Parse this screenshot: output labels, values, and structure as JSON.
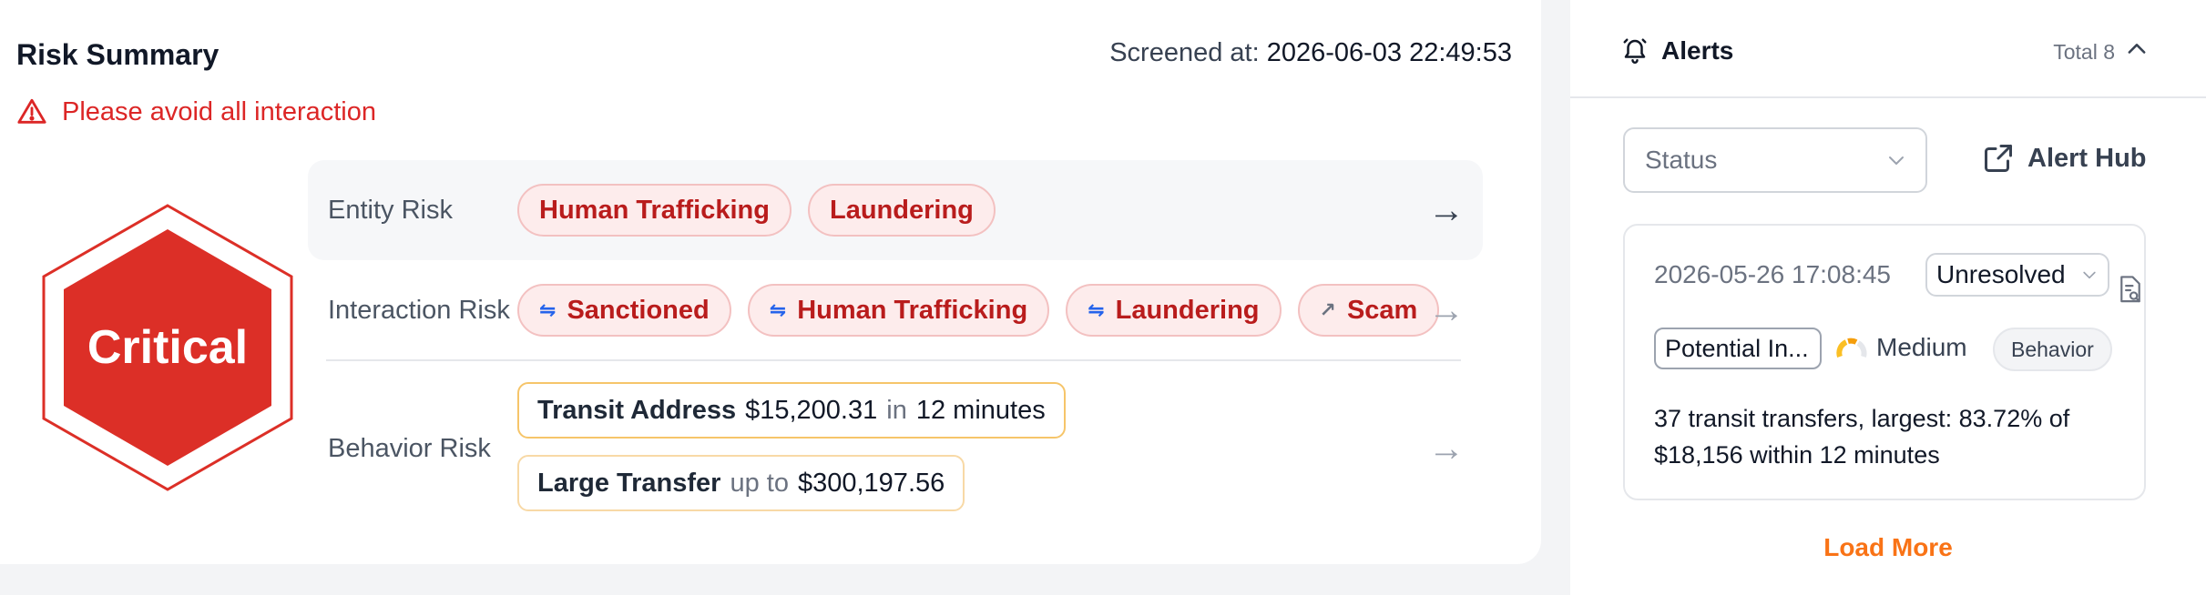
{
  "risk_summary": {
    "title": "Risk Summary",
    "screened_label": "Screened at:",
    "screened_at": "2026-06-03 22:49:53",
    "warning": "Please avoid all interaction",
    "level": "Critical",
    "level_color": "#dc2f27",
    "entity": {
      "label": "Entity Risk",
      "tags": [
        "Human Trafficking",
        "Laundering"
      ]
    },
    "interaction": {
      "label": "Interaction Risk",
      "tags": [
        {
          "label": "Sanctioned",
          "icon": "swap-arrows-icon",
          "glyph": "⇋"
        },
        {
          "label": "Human Trafficking",
          "icon": "swap-arrows-icon",
          "glyph": "⇋"
        },
        {
          "label": "Laundering",
          "icon": "swap-arrows-icon",
          "glyph": "⇋"
        },
        {
          "label": "Scam",
          "icon": "arrow-up-left-icon",
          "glyph": "↗"
        }
      ]
    },
    "behavior": {
      "label": "Behavior Risk",
      "items": [
        {
          "name": "Transit Address",
          "value": "$15,200.31",
          "connector": "in",
          "detail": "12 minutes"
        },
        {
          "name": "Large Transfer",
          "connector": "up to",
          "value": "$300,197.56"
        }
      ]
    },
    "arrow_glyph": "→"
  },
  "alerts": {
    "title": "Alerts",
    "total": "Total 8",
    "status_placeholder": "Status",
    "alert_hub": "Alert Hub",
    "items": [
      {
        "date": "2026-05-26 17:08:45",
        "status": "Unresolved",
        "type": "Potential In...",
        "severity": "Medium",
        "category": "Behavior",
        "description": "37 transit transfers, largest: 83.72% of $18,156 within 12 minutes"
      }
    ],
    "load_more": "Load More",
    "accent": "#f97316"
  }
}
